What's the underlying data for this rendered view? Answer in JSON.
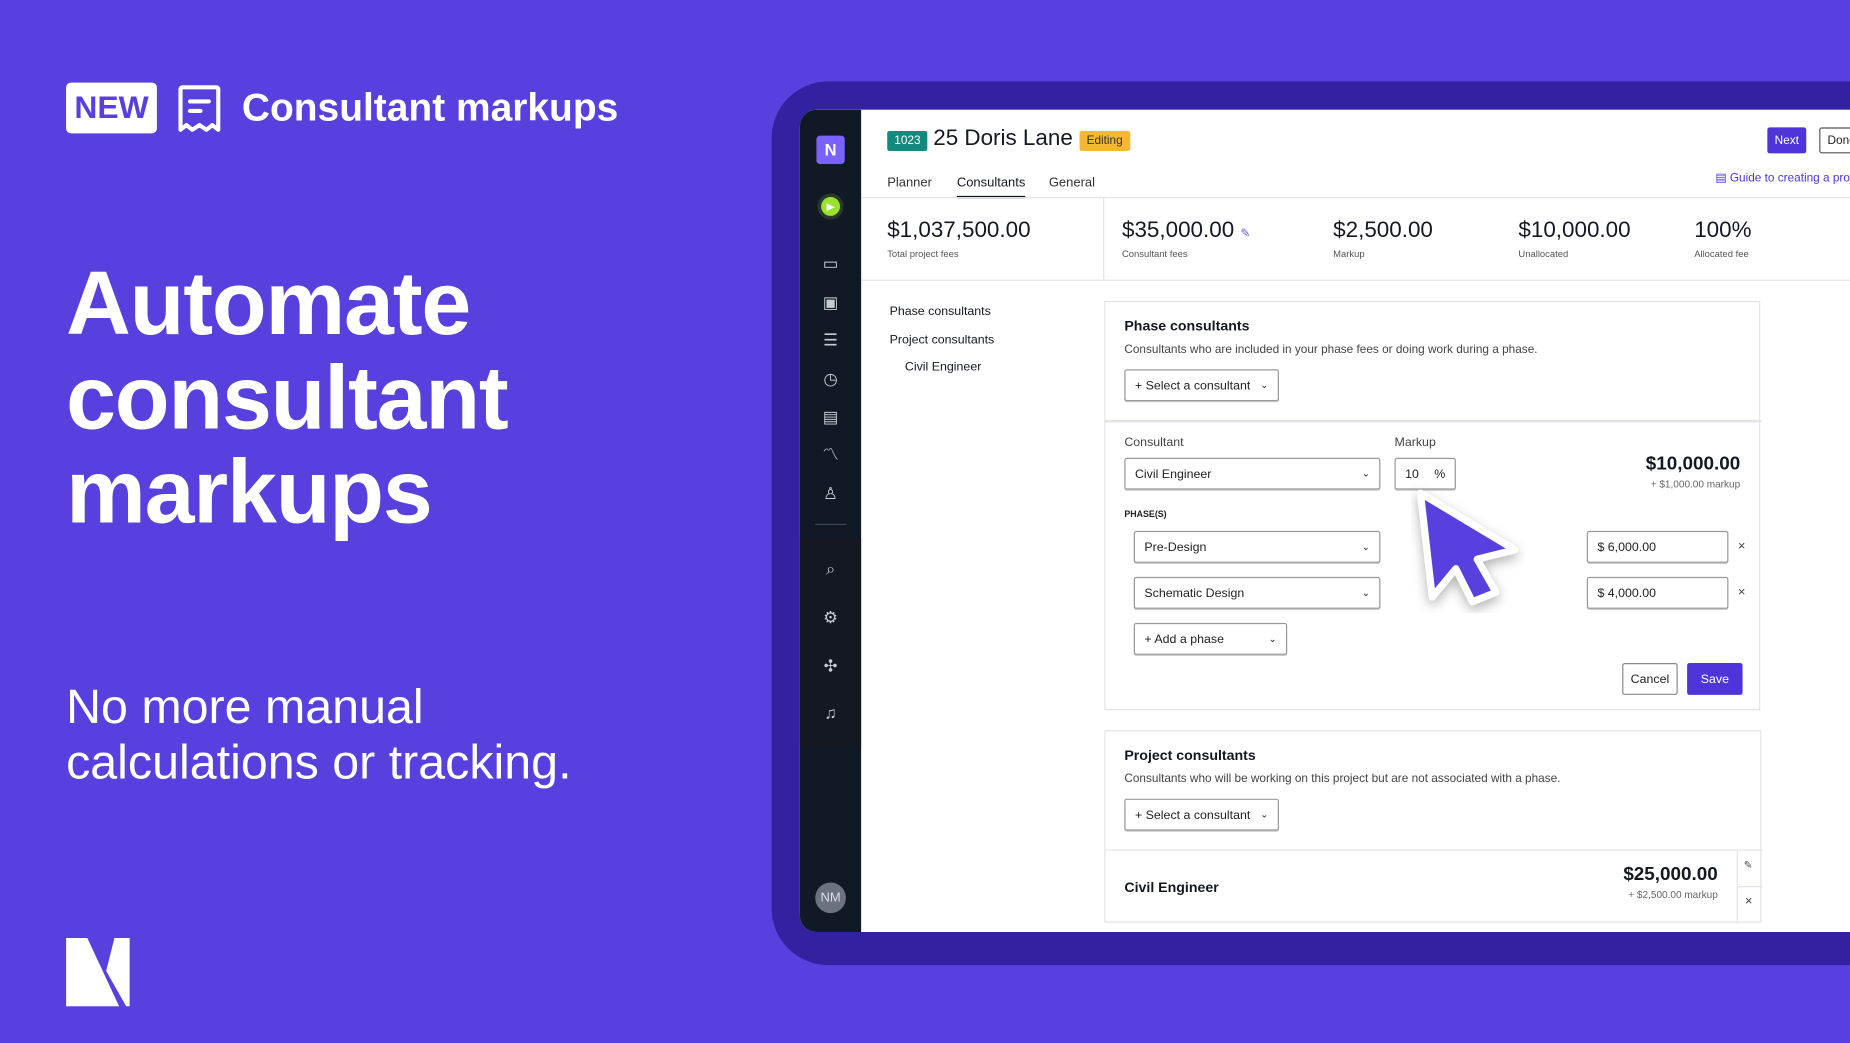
{
  "promo": {
    "badge": "NEW",
    "feature_title": "Consultant markups",
    "headline_lines": [
      "Automate",
      "consultant",
      "markups"
    ],
    "subtext_lines": [
      "No more manual",
      "calculations or tracking."
    ],
    "brand_color": "#5840DF"
  },
  "app": {
    "sidebar": {
      "avatar": "NM",
      "icons": [
        "logo-icon",
        "timer-play-icon",
        "monitor-icon",
        "board-icon",
        "gantt-icon",
        "clock-icon",
        "invoice-icon",
        "chart-icon",
        "person-icon",
        "search-icon",
        "gear-icon",
        "help-icon",
        "bell-icon"
      ]
    },
    "header": {
      "project_number": "1023",
      "title": "25 Doris Lane",
      "status": "Editing",
      "next": "Next",
      "done": "Done",
      "guide_link": "Guide to creating a project"
    },
    "tabs": [
      {
        "label": "Planner"
      },
      {
        "label": "Consultants",
        "active": true
      },
      {
        "label": "General"
      }
    ],
    "stats": [
      {
        "value": "$1,037,500.00",
        "label": "Total project fees"
      },
      {
        "value": "$35,000.00",
        "label": "Consultant fees"
      },
      {
        "value": "$2,500.00",
        "label": "Markup"
      },
      {
        "value": "$10,000.00",
        "label": "Unallocated"
      },
      {
        "value": "100%",
        "label": "Allocated fee"
      }
    ],
    "nav": {
      "phase": "Phase consultants",
      "project": "Project consultants",
      "civil": "Civil Engineer"
    },
    "phase_card": {
      "title": "Phase consultants",
      "desc": "Consultants who are included in your phase fees or doing work during a phase.",
      "select": "+ Select a consultant",
      "consultant_label": "Consultant",
      "consultant_value": "Civil Engineer",
      "markup_label": "Markup",
      "markup_value": "10",
      "markup_unit": "%",
      "total": "$10,000.00",
      "markup_note": "+ $1,000.00 markup",
      "phases_label": "PHASE(S)",
      "phases": [
        {
          "name": "Pre-Design",
          "amount": "$ 6,000.00"
        },
        {
          "name": "Schematic Design",
          "amount": "$ 4,000.00"
        }
      ],
      "add_phase": "+ Add a phase",
      "cancel": "Cancel",
      "save": "Save"
    },
    "project_card": {
      "title": "Project consultants",
      "desc": "Consultants who will be working on this project but are not associated with a phase.",
      "select": "+ Select a consultant",
      "row": {
        "name": "Civil Engineer",
        "total": "$25,000.00",
        "markup_note": "+ $2,500.00 markup"
      }
    }
  }
}
